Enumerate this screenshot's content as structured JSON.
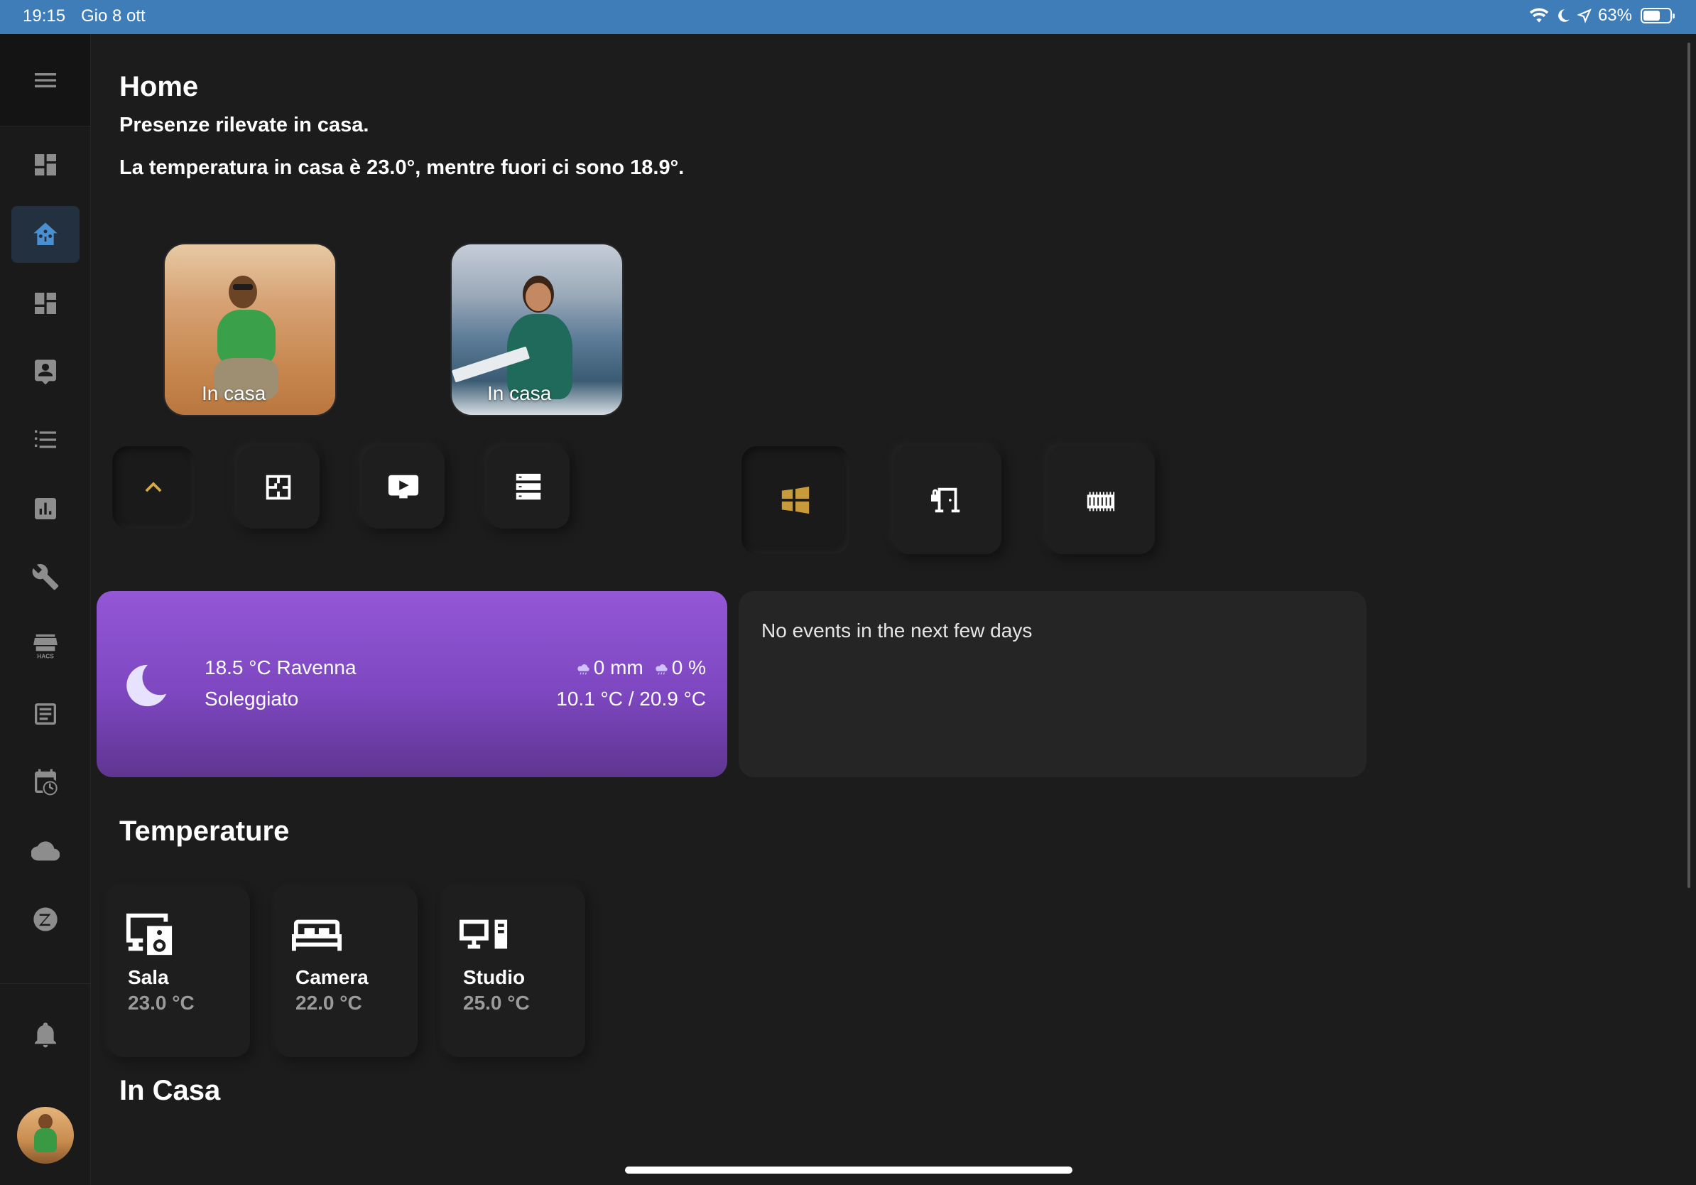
{
  "status_bar": {
    "time": "19:15",
    "date": "Gio 8 ott",
    "battery": "63%",
    "battery_level": 0.63
  },
  "sidebar": {
    "items": [
      {
        "name": "overview",
        "icon": "dashboard-icon"
      },
      {
        "name": "home",
        "icon": "home-assistant-icon",
        "active": true
      },
      {
        "name": "dashboard-2",
        "icon": "dashboard-icon"
      },
      {
        "name": "people",
        "icon": "account-box-icon"
      },
      {
        "name": "list",
        "icon": "format-list-icon"
      },
      {
        "name": "history",
        "icon": "chart-box-icon"
      },
      {
        "name": "developer-tools",
        "icon": "wrench-icon"
      },
      {
        "name": "hacs",
        "icon": "store-icon",
        "caption": "HACS"
      },
      {
        "name": "logbook",
        "icon": "text-box-icon"
      },
      {
        "name": "scheduler",
        "icon": "calendar-clock-icon"
      },
      {
        "name": "cloud",
        "icon": "cloud-icon"
      },
      {
        "name": "zigbee",
        "icon": "zigbee-icon"
      }
    ],
    "notifications": "bell-icon"
  },
  "header": {
    "title": "Home",
    "presence_text": "Presenze rilevate in casa.",
    "temperature_text": "La temperatura in casa è 23.0°, mentre fuori ci sono 18.9°."
  },
  "persons": [
    {
      "status": "In casa"
    },
    {
      "status": "In casa"
    }
  ],
  "quick_buttons": [
    {
      "icon": "chevron-up-icon",
      "color": "#d4a843"
    },
    {
      "icon": "floor-plan-icon"
    },
    {
      "icon": "television-play-icon"
    },
    {
      "icon": "server-icon"
    }
  ],
  "big_buttons": [
    {
      "icon": "window-icon",
      "color": "#c79a3a"
    },
    {
      "icon": "door-lock-icon"
    },
    {
      "icon": "gate-icon"
    }
  ],
  "weather": {
    "temp_location": "18.5 °C Ravenna",
    "condition": "Soleggiato",
    "precipitation": "0 mm",
    "precipitation_probability": "0 %",
    "min_max": "10.1 °C / 20.9 °C",
    "gradient_top": "#9457d6",
    "gradient_bottom": "#5f3590"
  },
  "calendar": {
    "message": "No events in the next few days"
  },
  "sections": {
    "temperature": "Temperature",
    "in_casa": "In Casa"
  },
  "temperatures": [
    {
      "name": "Sala",
      "value": "23.0 °C",
      "icon": "speaker-monitor-icon"
    },
    {
      "name": "Camera",
      "value": "22.0 °C",
      "icon": "bed-icon"
    },
    {
      "name": "Studio",
      "value": "25.0 °C",
      "icon": "desktop-tower-monitor-icon"
    }
  ]
}
